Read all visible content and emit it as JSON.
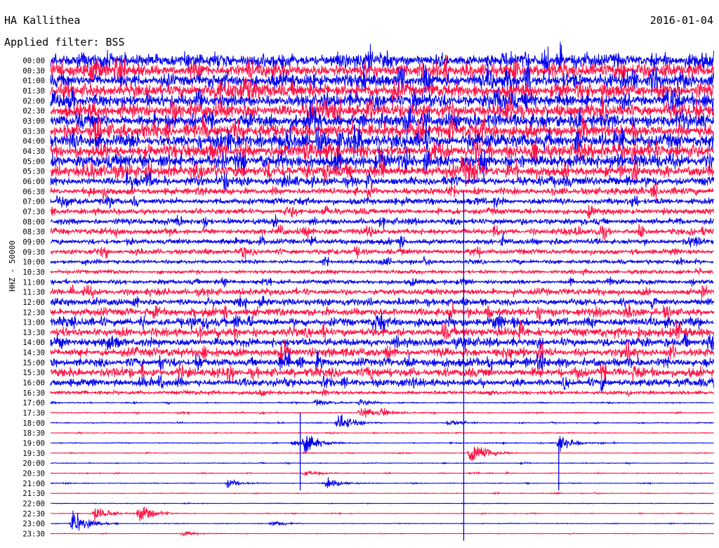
{
  "header": {
    "station": "HA Kallithea",
    "date": "2016-01-04",
    "filter": "Applied filter: BSS",
    "channel": "HHZ - 50000"
  },
  "colors": {
    "odd": "#0000ee",
    "even": "#ff1144",
    "background": "#ffffff"
  },
  "chart_data": {
    "type": "helicorder",
    "title": "HA Kallithea",
    "date": "2016-01-04",
    "ylabel": "HHZ - 50000",
    "rows": [
      "00:00",
      "00:30",
      "01:00",
      "01:30",
      "02:00",
      "02:30",
      "03:00",
      "03:30",
      "04:00",
      "04:30",
      "05:00",
      "05:30",
      "06:00",
      "06:30",
      "07:00",
      "07:30",
      "08:00",
      "08:30",
      "09:00",
      "09:30",
      "10:00",
      "10:30",
      "11:00",
      "11:30",
      "12:00",
      "12:30",
      "13:00",
      "13:30",
      "14:00",
      "14:30",
      "15:00",
      "15:30",
      "16:00",
      "16:30",
      "17:00",
      "17:30",
      "18:00",
      "18:30",
      "19:00",
      "19:30",
      "20:00",
      "20:30",
      "21:00",
      "21:30",
      "22:00",
      "22:30",
      "23:00",
      "23:30"
    ],
    "relative_noise": [
      3.6,
      3.6,
      3.6,
      3.6,
      3.6,
      3.6,
      3.6,
      3.6,
      3.6,
      3.5,
      3.4,
      3.0,
      2.3,
      1.7,
      1.6,
      1.5,
      1.5,
      1.5,
      1.4,
      1.4,
      1.0,
      0.9,
      1.1,
      1.6,
      1.8,
      2.0,
      2.2,
      2.3,
      2.2,
      2.2,
      2.1,
      2.2,
      1.9,
      0.9,
      0.25,
      0.25,
      0.2,
      0.2,
      0.2,
      0.18,
      0.18,
      0.18,
      0.18,
      0.18,
      0.16,
      0.16,
      0.16,
      0.16
    ],
    "row_colors": "alternating blue / red",
    "events": [
      {
        "row": "17:00",
        "minute": 14,
        "amplitude": 0.5
      },
      {
        "row": "17:00",
        "minute": 12,
        "amplitude": 0.7
      },
      {
        "row": "17:30",
        "minute": 14,
        "amplitude": 0.9
      },
      {
        "row": "17:30",
        "minute": 15,
        "amplitude": 0.7
      },
      {
        "row": "18:00",
        "minute": 13,
        "amplitude": 1.3
      },
      {
        "row": "18:00",
        "minute": 18,
        "amplitude": 0.5
      },
      {
        "row": "19:00",
        "minute": 11,
        "amplitude": 0.5
      },
      {
        "row": "19:00",
        "minute": 11.5,
        "amplitude": 1.6
      },
      {
        "row": "19:00",
        "minute": 23,
        "amplitude": 1.2
      },
      {
        "row": "19:30",
        "minute": 19,
        "amplitude": 1.8
      },
      {
        "row": "20:30",
        "minute": 11.5,
        "amplitude": 0.5
      },
      {
        "row": "21:00",
        "minute": 8,
        "amplitude": 0.6
      },
      {
        "row": "21:00",
        "minute": 12.5,
        "amplitude": 0.7
      },
      {
        "row": "22:30",
        "minute": 2,
        "amplitude": 1.0
      },
      {
        "row": "22:30",
        "minute": 4,
        "amplitude": 1.3
      },
      {
        "row": "23:00",
        "minute": 1,
        "amplitude": 2.0
      },
      {
        "row": "23:00",
        "minute": 10,
        "amplitude": 0.4
      },
      {
        "row": "23:30",
        "minute": 6,
        "amplitude": 0.4
      }
    ],
    "spikes": [
      {
        "minute": 18.7,
        "from_row": "06:30",
        "to_row": "23:30"
      },
      {
        "minute": 11.3,
        "from_row": "17:30",
        "to_row": "21:00"
      },
      {
        "minute": 23,
        "from_row": "19:00",
        "to_row": "21:00"
      }
    ]
  }
}
